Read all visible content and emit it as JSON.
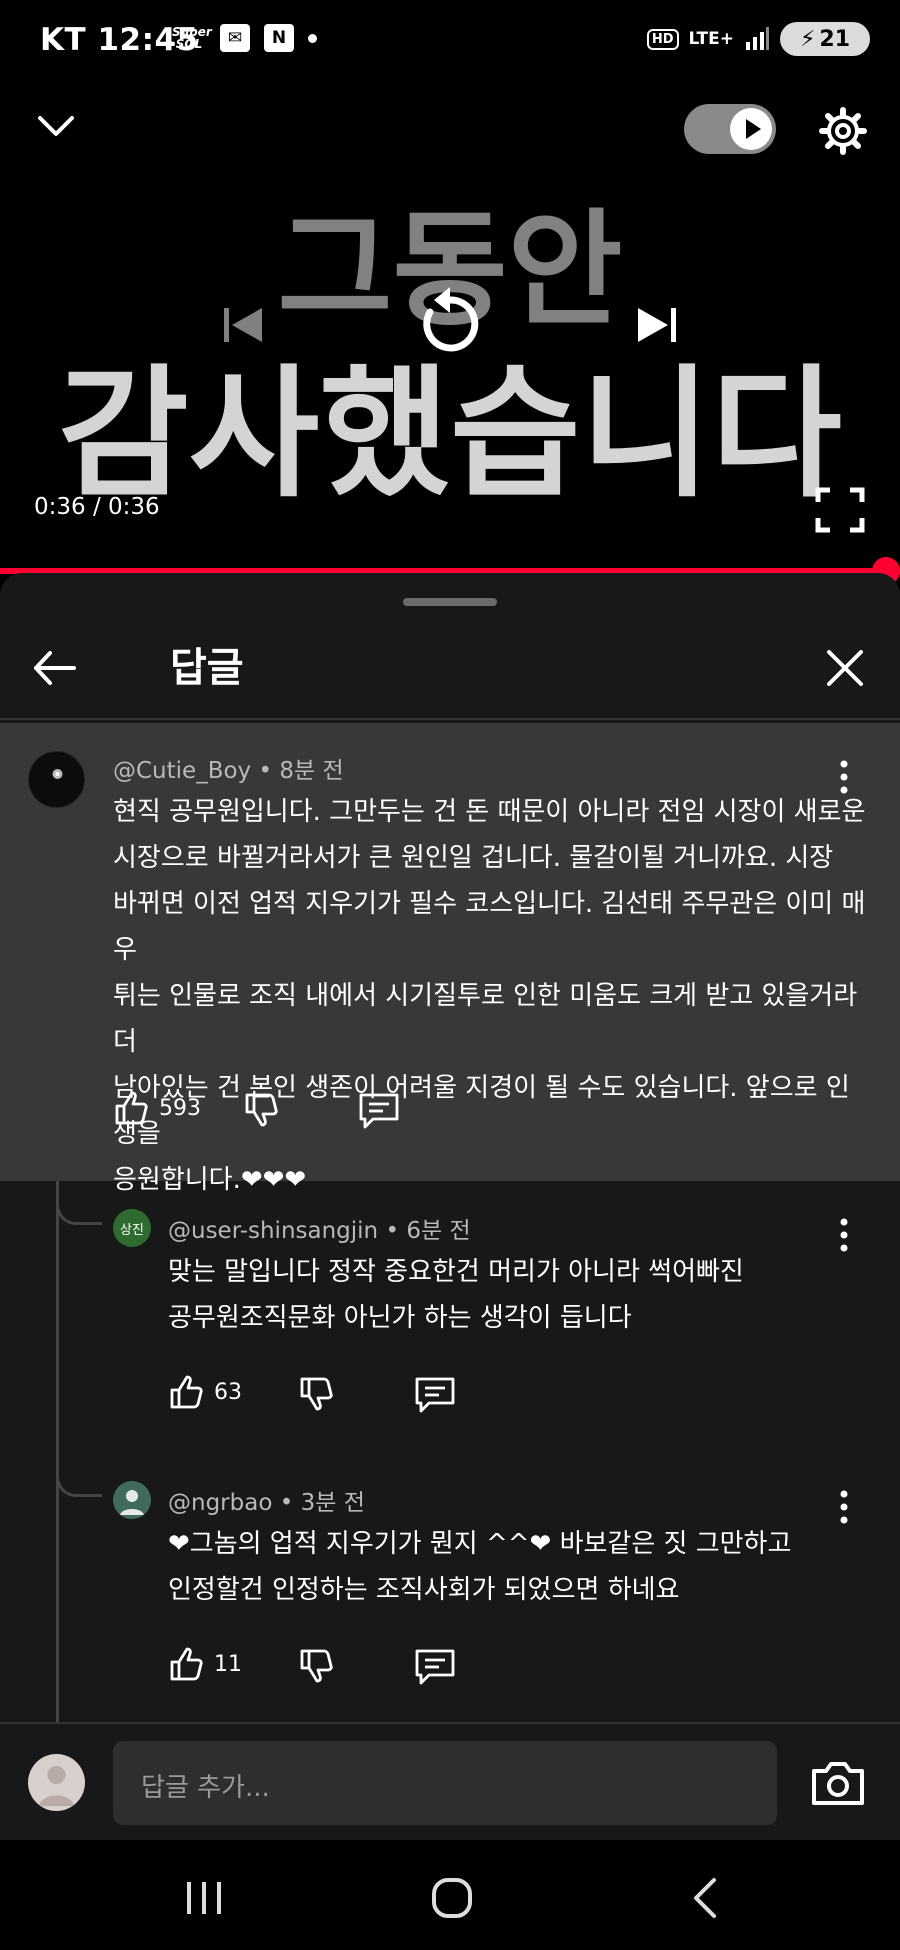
{
  "status_bar": {
    "carrier": "KT",
    "time": "12:45",
    "supersol_label": "Super SOL",
    "n_label": "N",
    "hd_label": "HD",
    "network": "LTE+",
    "battery": "21"
  },
  "video": {
    "overlay_line1": "그동안",
    "overlay_line2": "감사했습니다",
    "time": "0:36 / 0:36",
    "progress": 1.0,
    "progress_color": "#ff0033"
  },
  "panel": {
    "title": "답글"
  },
  "comments": [
    {
      "author": "@Cutie_Boy",
      "age": "8분 전",
      "lines": [
        "현직 공무원입니다. 그만두는 건 돈 때문이 아니라 전임 시장이 새로운",
        "시장으로 바뀔거라서가 큰 원인일 겁니다. 물갈이될 거니까요. 시장",
        "바뀌면 이전 업적 지우기가 필수 코스입니다. 김선태 주무관은 이미 매우",
        "튀는 인물로 조직 내에서 시기질투로 인한 미움도 크게 받고 있을거라 더",
        "남아있는 건 본인 생존이 어려울 지경이 될 수도 있습니다. 앞으로 인생을",
        "응원합니다.❤❤❤"
      ],
      "likes": "593"
    },
    {
      "author": "@user-shinsangjin",
      "age": "6분 전",
      "avatar_text": "상진",
      "lines": [
        "맞는 말입니다 정작 중요한건 머리가 아니라 썩어빠진",
        "공무원조직문화 아닌가 하는 생각이 듭니다"
      ],
      "likes": "63"
    },
    {
      "author": "@ngrbao",
      "age": "3분 전",
      "lines": [
        "❤그놈의 업적 지우기가 뭔지 ^^❤ 바보같은 짓 그만하고",
        "인정할건 인정하는 조직사회가 되었으면 하네요"
      ],
      "likes": "11"
    }
  ],
  "input": {
    "placeholder": "답글 추가..."
  },
  "colors": {
    "accent_red": "#ff0033",
    "heart": "#ff3b5c",
    "avatar_green": "#2e6b2e"
  }
}
